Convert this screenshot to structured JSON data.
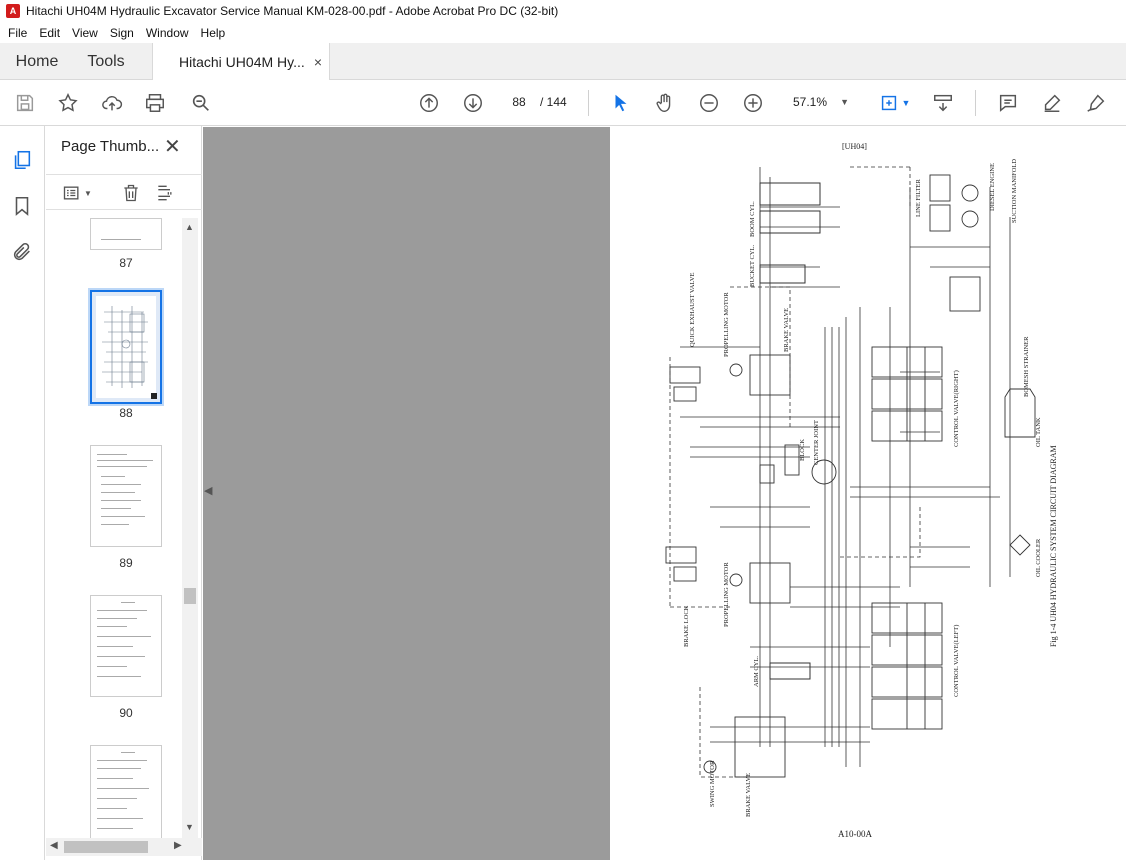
{
  "window": {
    "title": "Hitachi UH04M Hydraulic Excavator Service Manual KM-028-00.pdf - Adobe Acrobat Pro DC (32-bit)"
  },
  "menu": [
    "File",
    "Edit",
    "View",
    "Sign",
    "Window",
    "Help"
  ],
  "tabs": {
    "home": "Home",
    "tools": "Tools",
    "doc": "Hitachi UH04M Hy...",
    "close": "×"
  },
  "toolbar": {
    "page_current": "88",
    "page_total": "/  144",
    "zoom": "57.1%"
  },
  "panel": {
    "title": "Page Thumb...",
    "close": "✕",
    "thumbnails": [
      {
        "label": "87"
      },
      {
        "label": "88",
        "selected": true
      },
      {
        "label": "89"
      },
      {
        "label": "90"
      }
    ]
  },
  "diagram": {
    "header": "[UH04]",
    "footer": "A10-00A",
    "caption": "Fig 1-4   UH04 HYDRAULIC SYSTEM CIRCUIT DIAGRAM",
    "labels": {
      "quick_exhaust": "QUICK EXHAUST VALVE",
      "boom_cyl": "BOOM CYL.",
      "bucket_cyl": "BUCKET CYL.",
      "prop_motor_top": "PROPELLING MOTOR",
      "brake_valve_top": "BRAKE VALVE",
      "center_joint": "CENTER JOINT",
      "block": "BLOCK",
      "control_valve_right": "CONTROL VALVE(RIGHT)",
      "control_valve_left": "CONTROL VALVE(LEFT)",
      "oil_tank": "OIL TANK",
      "oil_cooler": "OIL COOLER",
      "bomesh": "BOMESH STRAINER",
      "diesel_engine": "DIESEL ENGINE",
      "suction_manifold": "SUCTION MANIFOLD",
      "line_filter": "LINE FILTER",
      "arm_cyl": "ARM CYL.",
      "swing_motor": "SWING MOTOR",
      "brake_valve_bottom": "BRAKE VALVE",
      "brake_lock": "BRAKE LOCK",
      "prop_motor_bottom": "PROPELLING MOTOR"
    }
  }
}
